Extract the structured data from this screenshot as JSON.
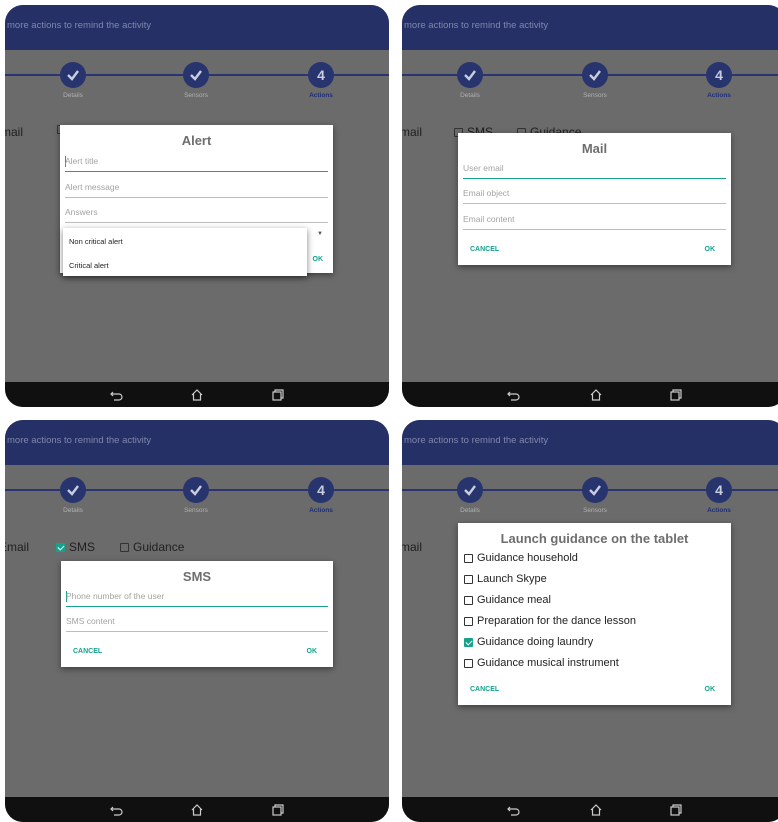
{
  "app": {
    "header_text": "more actions to remind the activity",
    "steps": [
      {
        "label": "Details",
        "state": "done"
      },
      {
        "label": "Sensors",
        "state": "done"
      },
      {
        "label": "Actions",
        "number": "4",
        "state": "active"
      }
    ],
    "options": {
      "email": "Email",
      "email_visible_1": "mail",
      "email_visible_2": "mail",
      "email_visible_3": "Email",
      "email_visible_4": "mail",
      "sms": "SMS",
      "guidance": "Guidance"
    },
    "nav": [
      "back-icon",
      "home-icon",
      "recent-apps-icon"
    ],
    "colors": {
      "appbar": "#253066",
      "accent": "#16a28c",
      "overlay": "#6b6b6b"
    }
  },
  "alert_dialog": {
    "title": "Alert",
    "fields": [
      {
        "placeholder": "Alert title",
        "value": ""
      },
      {
        "placeholder": "Alert message",
        "value": ""
      },
      {
        "placeholder": "Answers",
        "value": ""
      }
    ],
    "dropdown_options": [
      "Non critical alert",
      "Critical alert"
    ],
    "ok_label": "OK"
  },
  "mail_dialog": {
    "title": "Mail",
    "fields": [
      {
        "placeholder": "User email",
        "value": ""
      },
      {
        "placeholder": "Email object",
        "value": ""
      },
      {
        "placeholder": "Email content",
        "value": ""
      }
    ],
    "cancel_label": "CANCEL",
    "ok_label": "OK",
    "bg_sms": "SMS",
    "bg_guidance": "Guidance"
  },
  "sms_dialog": {
    "title": "SMS",
    "fields": [
      {
        "placeholder": "Phone number of the user",
        "value": ""
      },
      {
        "placeholder": "SMS content",
        "value": ""
      }
    ],
    "cancel_label": "CANCEL",
    "ok_label": "OK"
  },
  "guidance_dialog": {
    "title": "Launch guidance on the tablet",
    "items": [
      {
        "label": "Guidance household",
        "checked": false
      },
      {
        "label": "Launch Skype",
        "checked": false
      },
      {
        "label": "Guidance meal",
        "checked": false
      },
      {
        "label": "Preparation for the dance lesson",
        "checked": false
      },
      {
        "label": "Guidance doing laundry",
        "checked": true
      },
      {
        "label": "Guidance musical instrument",
        "checked": false
      }
    ],
    "cancel_label": "CANCEL",
    "ok_label": "OK"
  }
}
